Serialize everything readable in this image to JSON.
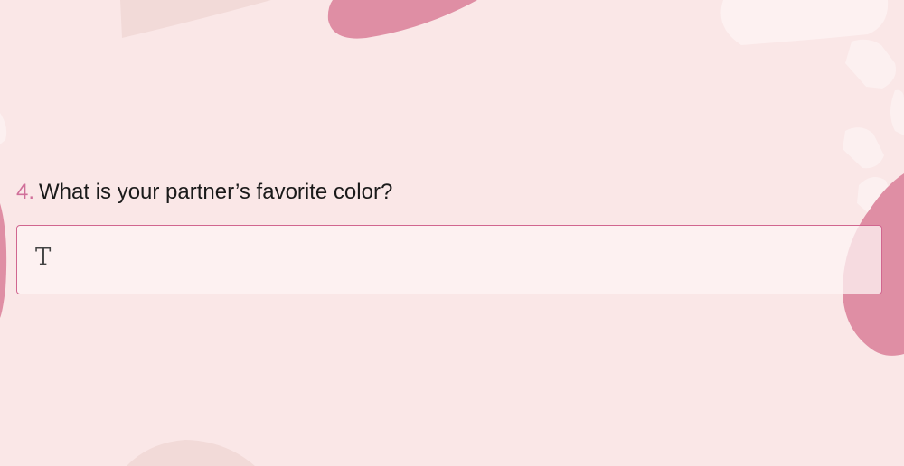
{
  "question": {
    "number": "4.",
    "text": "What is your partner’s favorite color?"
  },
  "answer_field": {
    "value": "",
    "icon": "text-type-icon"
  },
  "colors": {
    "background": "#fae7e7",
    "accent": "#d0709a",
    "blob": "#df8ea4",
    "field_border": "#d1668f"
  }
}
